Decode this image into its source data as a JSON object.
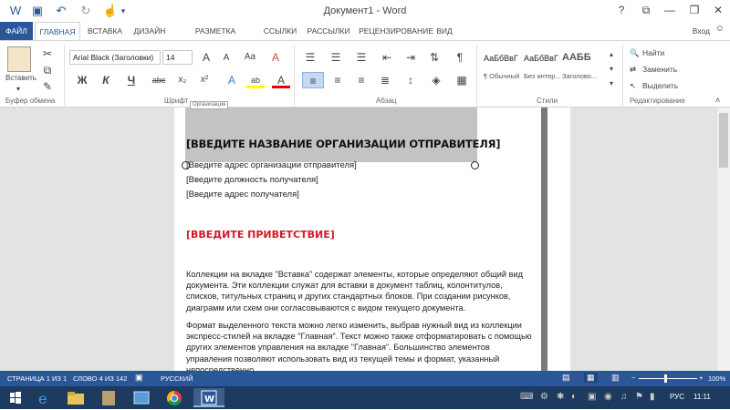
{
  "window": {
    "title": "Документ1 - Word",
    "help": "?",
    "minimize": "—",
    "restore": "❐",
    "close": "✕",
    "ribbon_display": "⧉"
  },
  "qat": {
    "save": "💾",
    "undo": "↶",
    "redo": "↻",
    "touch": "☝",
    "customize": "▾"
  },
  "tabs": [
    "ФАЙЛ",
    "ГЛАВНАЯ",
    "ВСТАВКА",
    "ДИЗАЙН",
    "РАЗМЕТКА СТРАНИЦЫ",
    "ССЫЛКИ",
    "РАССЫЛКИ",
    "РЕЦЕНЗИРОВАНИЕ",
    "ВИД"
  ],
  "login": "Вход",
  "ribbon": {
    "clipboard": {
      "paste": "Вставить",
      "label": "Буфер обмена"
    },
    "font": {
      "family": "Arial Black (Заголовки)",
      "size": "14",
      "label": "Шрифт",
      "bold": "Ж",
      "italic": "К",
      "underline": "Ч",
      "strike": "abc",
      "sub": "x₂",
      "sup": "x²",
      "grow": "A",
      "shrink": "A",
      "case": "Aa",
      "clear": "A",
      "effects": "A",
      "highlight": "ab",
      "color": "A"
    },
    "paragraph": {
      "label": "Абзац",
      "show_marks": "¶"
    },
    "styles": {
      "label": "Стили",
      "items": [
        {
          "preview": "АаБбВвГ",
          "caption": "¶ Обычный"
        },
        {
          "preview": "АаБбВвГ",
          "caption": "Без интер..."
        },
        {
          "preview": "ААББ",
          "caption": "Заголово..."
        }
      ]
    },
    "editing": {
      "label": "Редактирование",
      "find": "Найти",
      "replace": "Заменить",
      "select": "Выделить"
    }
  },
  "document": {
    "header_tag": "Организация",
    "org_name": "[ВВЕДИТЕ НАЗВАНИЕ ОРГАНИЗАЦИИ ОТПРАВИТЕЛЯ]",
    "org_address": "[Введите адрес организации отправителя]",
    "recipient_title": "[Введите должность получателя]",
    "recipient_address": "[Введите адрес получателя]",
    "greeting": "[ВВЕДИТЕ ПРИВЕТСТВИЕ]",
    "para1": "Коллекции на вкладке \"Вставка\" содержат элементы, которые определяют общий вид документа. Эти коллекции служат для вставки в документ таблиц, колонтитулов, списков, титульных страниц и других стандартных блоков. При создании рисунков, диаграмм или схем они согласовываются с видом текущего документа.",
    "para2": "Формат выделенного текста можно легко изменить, выбрав нужный вид из коллекции экспресс-стилей на вкладке \"Главная\". Текст можно также отформатировать с помощью других элементов управления на вкладке \"Главная\". Большинство элементов управления позволяют использовать вид из текущей темы и формат, указанный непосредственно."
  },
  "status": {
    "page": "СТРАНИЦА 1 ИЗ 1",
    "words": "СЛОВО 4 ИЗ 142",
    "language": "РУССКИЙ",
    "zoom": "100%",
    "zoom_minus": "−",
    "zoom_plus": "+"
  },
  "taskbar": {
    "lang": "РУС",
    "time": "11:11"
  },
  "colors": {
    "accent": "#2b579a",
    "greeting": "#d4182a",
    "taskbar": "#1d3a5f"
  }
}
